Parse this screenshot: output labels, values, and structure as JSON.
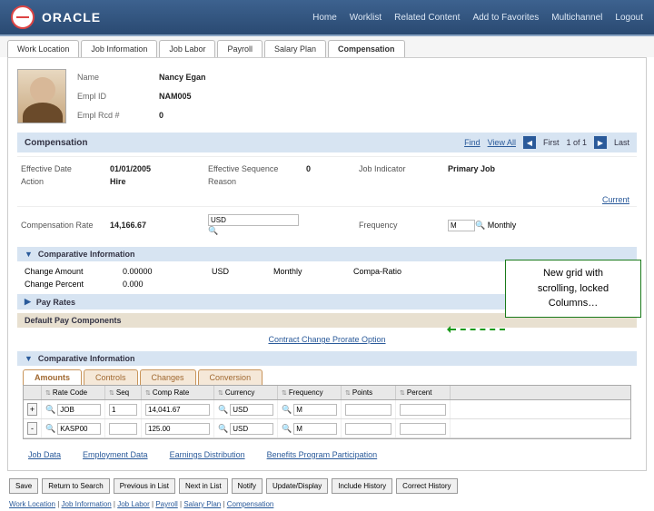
{
  "header": {
    "brand": "ORACLE",
    "nav": [
      "Home",
      "Worklist",
      "Related Content",
      "Add to Favorites",
      "Multichannel",
      "Logout"
    ]
  },
  "tabs": [
    "Work Location",
    "Job Information",
    "Job Labor",
    "Payroll",
    "Salary Plan",
    "Compensation"
  ],
  "active_tab": "Compensation",
  "profile": {
    "fields": [
      {
        "label": "Name",
        "value": "Nancy Egan"
      },
      {
        "label": "Empl ID",
        "value": "NAM005"
      },
      {
        "label": "Empl Rcd #",
        "value": "0"
      }
    ]
  },
  "comp_section": {
    "title": "Compensation",
    "find": "Find",
    "viewall": "View All",
    "first": "First",
    "counter": "1 of 1",
    "last": "Last"
  },
  "form": {
    "eff_date_lbl": "Effective Date",
    "eff_date_val": "01/01/2005",
    "eff_seq_lbl": "Effective Sequence",
    "eff_seq_val": "0",
    "job_ind_lbl": "Job Indicator",
    "job_ind_val": "Primary Job",
    "action_lbl": "Action",
    "action_val": "Hire",
    "reason_lbl": "Reason",
    "reason_val": "",
    "comp_rate_lbl": "Compensation Rate",
    "comp_rate_val": "14,166.67",
    "currency": "USD",
    "freq_lbl": "Frequency",
    "freq_code": "M",
    "freq_text": "Monthly",
    "current_link": "Current"
  },
  "comparative": {
    "title": "Comparative Information",
    "change_amt_lbl": "Change Amount",
    "change_amt_val": "0.00000",
    "change_cur": "USD",
    "change_freq": "Monthly",
    "compa_lbl": "Compa-Ratio",
    "change_pct_lbl": "Change Percent",
    "change_pct_val": "0.000"
  },
  "pay_rates": {
    "title": "Pay Rates"
  },
  "default_comp": {
    "title": "Default Pay Components",
    "link": "Contract Change Prorate Option"
  },
  "comparative2": {
    "title": "Comparative Information"
  },
  "inner_tabs": [
    "Amounts",
    "Controls",
    "Changes",
    "Conversion"
  ],
  "grid": {
    "cols": [
      "",
      "Rate Code",
      "Seq",
      "Comp Rate",
      "Currency",
      "Frequency",
      "Points",
      "Percent"
    ],
    "rows": [
      {
        "pm": "+",
        "code": "JOB",
        "seq": "1",
        "rate": "14,041.67",
        "cur": "USD",
        "freq": "M",
        "pts": "",
        "pct": ""
      },
      {
        "pm": "-",
        "code": "KASP00",
        "seq": "",
        "rate": "125.00",
        "cur": "USD",
        "freq": "M",
        "pts": "",
        "pct": ""
      }
    ]
  },
  "bottom_links": [
    "Job Data",
    "Employment Data",
    "Earnings Distribution",
    "Benefits Program Participation"
  ],
  "actions": [
    "Save",
    "Return to Search",
    "Previous in List",
    "Next in List",
    "Notify",
    "Update/Display",
    "Include History",
    "Correct History"
  ],
  "breadcrumbs": [
    "Work Location",
    "Job Information",
    "Job Labor",
    "Payroll",
    "Salary Plan",
    "Compensation"
  ],
  "callout": {
    "l1": "New grid with",
    "l2": "scrolling, locked",
    "l3": "Columns…"
  }
}
